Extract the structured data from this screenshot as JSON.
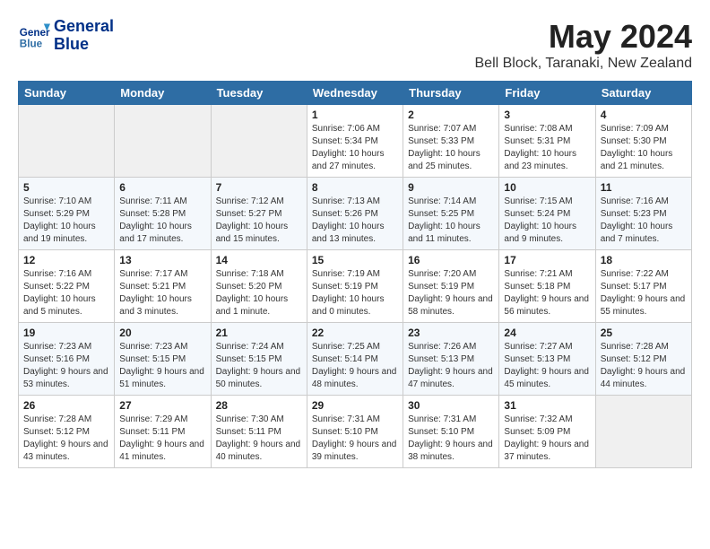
{
  "header": {
    "logo_line1": "General",
    "logo_line2": "Blue",
    "month": "May 2024",
    "location": "Bell Block, Taranaki, New Zealand"
  },
  "weekdays": [
    "Sunday",
    "Monday",
    "Tuesday",
    "Wednesday",
    "Thursday",
    "Friday",
    "Saturday"
  ],
  "weeks": [
    [
      {
        "day": "",
        "empty": true
      },
      {
        "day": "",
        "empty": true
      },
      {
        "day": "",
        "empty": true
      },
      {
        "day": "1",
        "sunrise": "7:06 AM",
        "sunset": "5:34 PM",
        "daylight": "10 hours and 27 minutes."
      },
      {
        "day": "2",
        "sunrise": "7:07 AM",
        "sunset": "5:33 PM",
        "daylight": "10 hours and 25 minutes."
      },
      {
        "day": "3",
        "sunrise": "7:08 AM",
        "sunset": "5:31 PM",
        "daylight": "10 hours and 23 minutes."
      },
      {
        "day": "4",
        "sunrise": "7:09 AM",
        "sunset": "5:30 PM",
        "daylight": "10 hours and 21 minutes."
      }
    ],
    [
      {
        "day": "5",
        "sunrise": "7:10 AM",
        "sunset": "5:29 PM",
        "daylight": "10 hours and 19 minutes."
      },
      {
        "day": "6",
        "sunrise": "7:11 AM",
        "sunset": "5:28 PM",
        "daylight": "10 hours and 17 minutes."
      },
      {
        "day": "7",
        "sunrise": "7:12 AM",
        "sunset": "5:27 PM",
        "daylight": "10 hours and 15 minutes."
      },
      {
        "day": "8",
        "sunrise": "7:13 AM",
        "sunset": "5:26 PM",
        "daylight": "10 hours and 13 minutes."
      },
      {
        "day": "9",
        "sunrise": "7:14 AM",
        "sunset": "5:25 PM",
        "daylight": "10 hours and 11 minutes."
      },
      {
        "day": "10",
        "sunrise": "7:15 AM",
        "sunset": "5:24 PM",
        "daylight": "10 hours and 9 minutes."
      },
      {
        "day": "11",
        "sunrise": "7:16 AM",
        "sunset": "5:23 PM",
        "daylight": "10 hours and 7 minutes."
      }
    ],
    [
      {
        "day": "12",
        "sunrise": "7:16 AM",
        "sunset": "5:22 PM",
        "daylight": "10 hours and 5 minutes."
      },
      {
        "day": "13",
        "sunrise": "7:17 AM",
        "sunset": "5:21 PM",
        "daylight": "10 hours and 3 minutes."
      },
      {
        "day": "14",
        "sunrise": "7:18 AM",
        "sunset": "5:20 PM",
        "daylight": "10 hours and 1 minute."
      },
      {
        "day": "15",
        "sunrise": "7:19 AM",
        "sunset": "5:19 PM",
        "daylight": "10 hours and 0 minutes."
      },
      {
        "day": "16",
        "sunrise": "7:20 AM",
        "sunset": "5:19 PM",
        "daylight": "9 hours and 58 minutes."
      },
      {
        "day": "17",
        "sunrise": "7:21 AM",
        "sunset": "5:18 PM",
        "daylight": "9 hours and 56 minutes."
      },
      {
        "day": "18",
        "sunrise": "7:22 AM",
        "sunset": "5:17 PM",
        "daylight": "9 hours and 55 minutes."
      }
    ],
    [
      {
        "day": "19",
        "sunrise": "7:23 AM",
        "sunset": "5:16 PM",
        "daylight": "9 hours and 53 minutes."
      },
      {
        "day": "20",
        "sunrise": "7:23 AM",
        "sunset": "5:15 PM",
        "daylight": "9 hours and 51 minutes."
      },
      {
        "day": "21",
        "sunrise": "7:24 AM",
        "sunset": "5:15 PM",
        "daylight": "9 hours and 50 minutes."
      },
      {
        "day": "22",
        "sunrise": "7:25 AM",
        "sunset": "5:14 PM",
        "daylight": "9 hours and 48 minutes."
      },
      {
        "day": "23",
        "sunrise": "7:26 AM",
        "sunset": "5:13 PM",
        "daylight": "9 hours and 47 minutes."
      },
      {
        "day": "24",
        "sunrise": "7:27 AM",
        "sunset": "5:13 PM",
        "daylight": "9 hours and 45 minutes."
      },
      {
        "day": "25",
        "sunrise": "7:28 AM",
        "sunset": "5:12 PM",
        "daylight": "9 hours and 44 minutes."
      }
    ],
    [
      {
        "day": "26",
        "sunrise": "7:28 AM",
        "sunset": "5:12 PM",
        "daylight": "9 hours and 43 minutes."
      },
      {
        "day": "27",
        "sunrise": "7:29 AM",
        "sunset": "5:11 PM",
        "daylight": "9 hours and 41 minutes."
      },
      {
        "day": "28",
        "sunrise": "7:30 AM",
        "sunset": "5:11 PM",
        "daylight": "9 hours and 40 minutes."
      },
      {
        "day": "29",
        "sunrise": "7:31 AM",
        "sunset": "5:10 PM",
        "daylight": "9 hours and 39 minutes."
      },
      {
        "day": "30",
        "sunrise": "7:31 AM",
        "sunset": "5:10 PM",
        "daylight": "9 hours and 38 minutes."
      },
      {
        "day": "31",
        "sunrise": "7:32 AM",
        "sunset": "5:09 PM",
        "daylight": "9 hours and 37 minutes."
      },
      {
        "day": "",
        "empty": true
      }
    ]
  ]
}
